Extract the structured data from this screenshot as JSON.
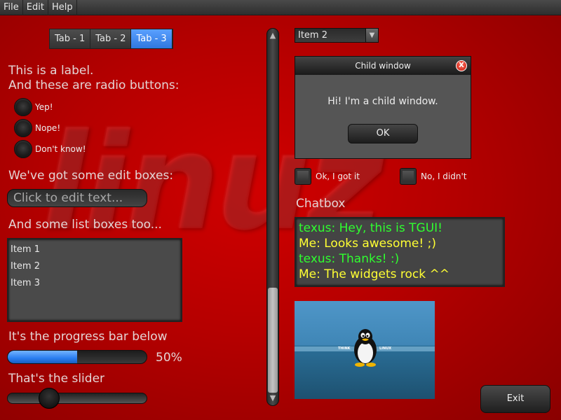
{
  "menu": [
    "File",
    "Edit",
    "Help"
  ],
  "tabs": [
    {
      "label": "Tab - 1",
      "selected": false
    },
    {
      "label": "Tab - 2",
      "selected": false
    },
    {
      "label": "Tab - 3",
      "selected": true
    }
  ],
  "labels": {
    "intro_line1": "This is a label.",
    "intro_line2": "And these are radio buttons:",
    "edit_heading": "We've got some edit boxes:",
    "list_heading": "And some list boxes too...",
    "progress_heading": "It's the progress bar below",
    "slider_heading": "That's the slider",
    "chatbox_heading": "Chatbox"
  },
  "radios": [
    "Yep!",
    "Nope!",
    "Don't know!"
  ],
  "editbox": {
    "placeholder": "Click to edit text..."
  },
  "listbox": {
    "items": [
      "Item 1",
      "Item 2",
      "Item 3"
    ]
  },
  "progress": {
    "value": 0.5,
    "label": "50%"
  },
  "slider": {
    "value": 0.3
  },
  "combo": {
    "selected": "Item 2"
  },
  "child_window": {
    "title": "Child window",
    "message": "Hi! I'm a child window.",
    "ok_label": "OK",
    "close_label": "X"
  },
  "checkboxes": [
    "Ok, I got it",
    "No, I didn't"
  ],
  "chat": [
    {
      "text": "texus: Hey, this is TGUI!",
      "color": "#2fff2f"
    },
    {
      "text": "Me: Looks awesome! ;)",
      "color": "#ffff33"
    },
    {
      "text": "texus: Thanks! :)",
      "color": "#2fff2f"
    },
    {
      "text": "Me: The widgets rock ^^",
      "color": "#ffff33"
    }
  ],
  "picture": {
    "left_text": "THINK",
    "right_text": "LINUX",
    "icon": "tux-penguin-icon"
  },
  "exit_label": "Exit",
  "colors": {
    "accent": "#2f78e0",
    "background": "#c00000"
  }
}
